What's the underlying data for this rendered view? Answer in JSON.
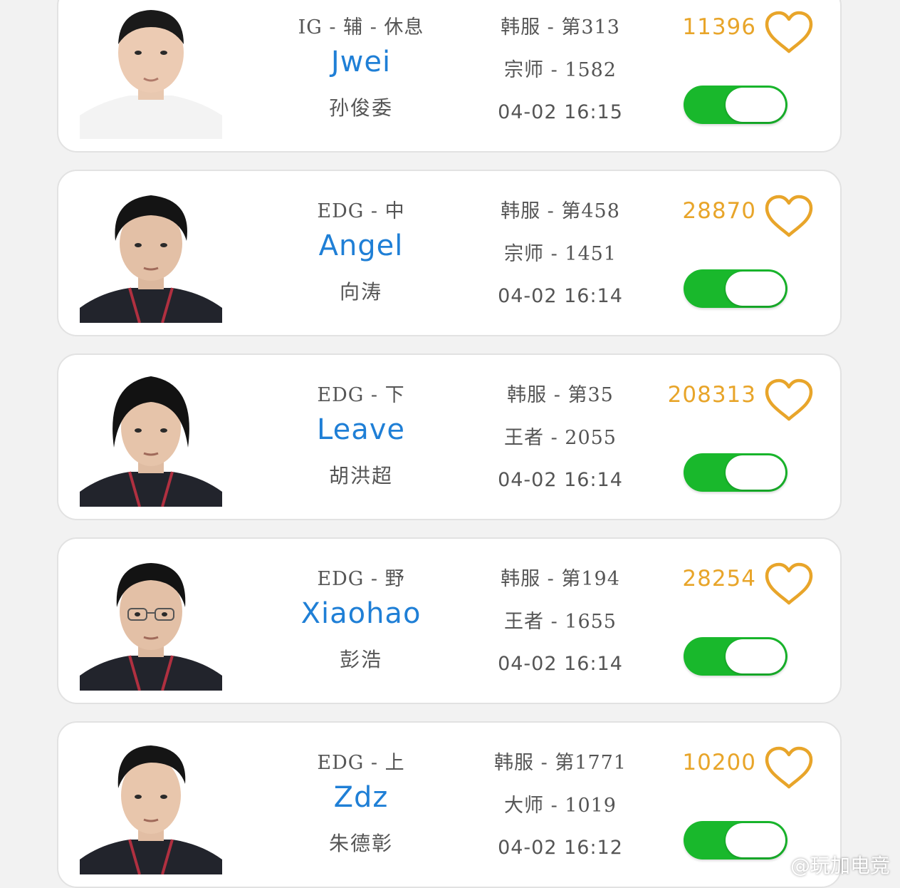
{
  "colors": {
    "accent_name": "#1f7fd6",
    "likes": "#e8a52a",
    "toggle_on": "#19b82c"
  },
  "players": [
    {
      "team_role": "IG - 辅 - 休息",
      "ign": "Jwei",
      "real_name": "孙俊委",
      "server_rank": "韩服 - 第313",
      "tier": "宗师 - 1582",
      "time": "04-02 16:15",
      "likes": "11396",
      "jersey": "#f3f3f3",
      "toggle_on": true
    },
    {
      "team_role": "EDG - 中",
      "ign": "Angel",
      "real_name": "向涛",
      "server_rank": "韩服 - 第458",
      "tier": "宗师 - 1451",
      "time": "04-02 16:14",
      "likes": "28870",
      "jersey": "#22242c",
      "toggle_on": true
    },
    {
      "team_role": "EDG - 下",
      "ign": "Leave",
      "real_name": "胡洪超",
      "server_rank": "韩服 - 第35",
      "tier": "王者 - 2055",
      "time": "04-02 16:14",
      "likes": "208313",
      "jersey": "#22242c",
      "toggle_on": true
    },
    {
      "team_role": "EDG - 野",
      "ign": "Xiaohao",
      "real_name": "彭浩",
      "server_rank": "韩服 - 第194",
      "tier": "王者 - 1655",
      "time": "04-02 16:14",
      "likes": "28254",
      "jersey": "#22242c",
      "toggle_on": true
    },
    {
      "team_role": "EDG - 上",
      "ign": "Zdz",
      "real_name": "朱德彰",
      "server_rank": "韩服 - 第1771",
      "tier": "大师 - 1019",
      "time": "04-02 16:12",
      "likes": "10200",
      "jersey": "#22242c",
      "toggle_on": true
    }
  ],
  "watermark": "@玩加电竞"
}
